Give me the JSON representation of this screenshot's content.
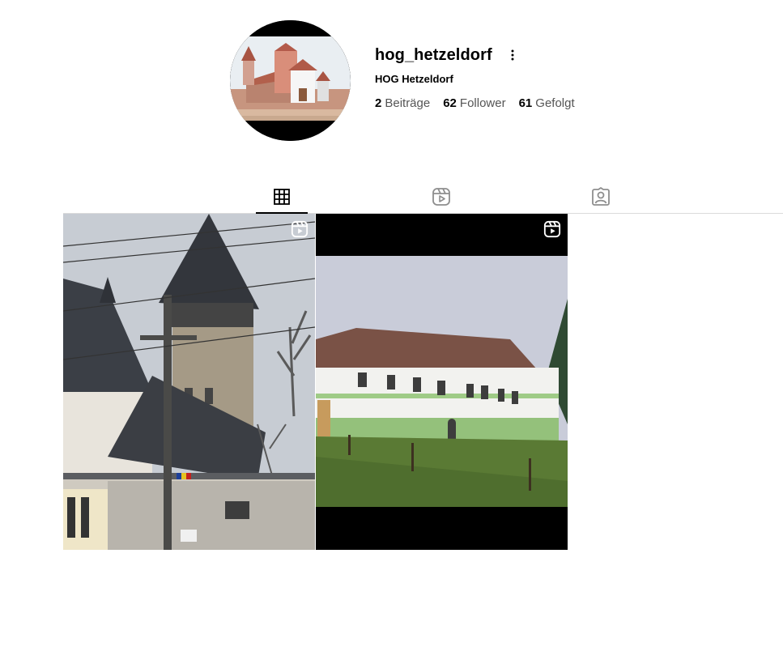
{
  "profile": {
    "username": "hog_hetzeldorf",
    "full_name": "HOG Hetzeldorf",
    "stats": [
      {
        "count": "2",
        "label": "Beiträge"
      },
      {
        "count": "62",
        "label": "Follower"
      },
      {
        "count": "61",
        "label": "Gefolgt"
      }
    ]
  },
  "tabs": [
    {
      "name": "posts",
      "icon": "grid-icon",
      "active": true
    },
    {
      "name": "reels",
      "icon": "reels-icon",
      "active": false
    },
    {
      "name": "tagged",
      "icon": "tagged-icon",
      "active": false
    }
  ],
  "posts": [
    {
      "type": "reel",
      "icon": "reels-icon",
      "content": "fortified church tower with power lines"
    },
    {
      "type": "reel",
      "icon": "reels-icon",
      "content": "long white building with green trim on grassy slope"
    }
  ]
}
